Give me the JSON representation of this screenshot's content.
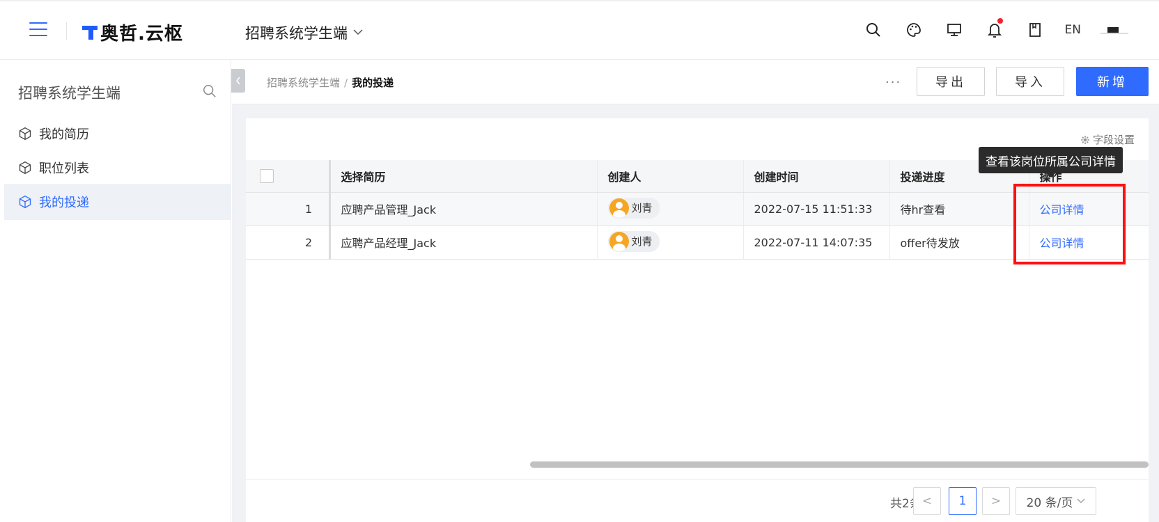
{
  "header": {
    "logo_text": "奥哲.云枢",
    "app_switch": "招聘系统学生端",
    "lang": "EN"
  },
  "sidebar": {
    "title": "招聘系统学生端",
    "items": [
      {
        "label": "我的简历"
      },
      {
        "label": "职位列表"
      },
      {
        "label": "我的投递",
        "active": true
      }
    ]
  },
  "breadcrumb": {
    "parent": "招聘系统学生端",
    "current": "我的投递"
  },
  "toolbar": {
    "more_label": "···",
    "export_label": "导出",
    "import_label": "导入",
    "add_label": "新增"
  },
  "card": {
    "field_settings": "字段设置"
  },
  "table": {
    "columns": [
      "选择简历",
      "创建人",
      "创建时间",
      "投递进度",
      "操作"
    ],
    "rows": [
      {
        "index": "1",
        "resume": "应聘产品管理_Jack",
        "owner": "刘青",
        "created": "2022-07-15 11:51:33",
        "progress": "待hr查看",
        "action": "公司详情"
      },
      {
        "index": "2",
        "resume": "应聘产品经理_Jack",
        "owner": "刘青",
        "created": "2022-07-11 14:07:35",
        "progress": "offer待发放",
        "action": "公司详情"
      }
    ]
  },
  "tooltip": "查看该岗位所属公司详情",
  "pagination": {
    "total": "共2条",
    "prev": "<",
    "current": "1",
    "next": ">",
    "page_size": "20 条/页"
  },
  "colors": {
    "accent": "#2f6bff",
    "highlight": "#ff1010",
    "notification": "#f5222d"
  }
}
